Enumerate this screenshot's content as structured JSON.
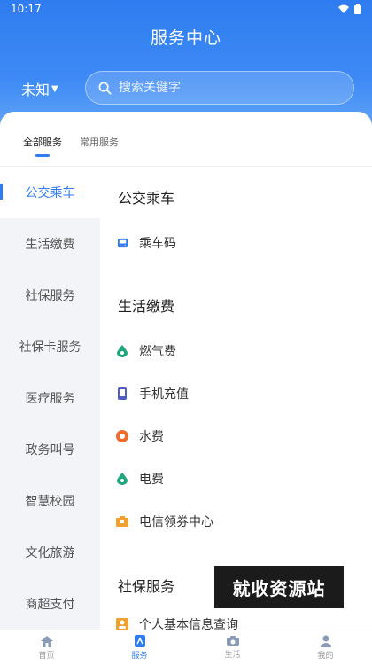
{
  "status_bar": {
    "time": "10:17"
  },
  "header": {
    "title": "服务中心",
    "region": "未知",
    "search_placeholder": "搜索关键字"
  },
  "tabs": [
    {
      "label": "全部服务",
      "active": true
    },
    {
      "label": "常用服务",
      "active": false
    }
  ],
  "sidebar": [
    {
      "label": "公交乘车",
      "active": true
    },
    {
      "label": "生活缴费",
      "active": false
    },
    {
      "label": "社保服务",
      "active": false
    },
    {
      "label": "社保卡服务",
      "active": false
    },
    {
      "label": "医疗服务",
      "active": false
    },
    {
      "label": "政务叫号",
      "active": false
    },
    {
      "label": "智慧校园",
      "active": false
    },
    {
      "label": "文化旅游",
      "active": false
    },
    {
      "label": "商超支付",
      "active": false
    }
  ],
  "sections": [
    {
      "title": "公交乘车",
      "items": [
        {
          "label": "乘车码",
          "icon": "bus-icon",
          "color": "#2f7cf0"
        }
      ]
    },
    {
      "title": "生活缴费",
      "items": [
        {
          "label": "燃气费",
          "icon": "gas-drop-icon",
          "color": "#1fa67a"
        },
        {
          "label": "手机充值",
          "icon": "phone-icon",
          "color": "#4b5cc4"
        },
        {
          "label": "水费",
          "icon": "water-icon",
          "color": "#ef6b2b"
        },
        {
          "label": "电费",
          "icon": "electric-drop-icon",
          "color": "#1fa67a"
        },
        {
          "label": "电信领券中心",
          "icon": "coupon-icon",
          "color": "#f0a030"
        }
      ]
    },
    {
      "title": "社保服务",
      "items": [
        {
          "label": "个人基本信息查询",
          "icon": "person-icon",
          "color": "#f0a030"
        }
      ]
    }
  ],
  "watermark": "就收资源站",
  "bottom_nav": [
    {
      "label": "首页",
      "icon": "home-icon",
      "active": false
    },
    {
      "label": "服务",
      "icon": "service-icon",
      "active": true
    },
    {
      "label": "生活",
      "icon": "life-icon",
      "active": false
    },
    {
      "label": "我的",
      "icon": "profile-icon",
      "active": false
    }
  ],
  "colors": {
    "primary": "#2f7cf0",
    "sidebar_bg": "#f3f4f7"
  }
}
